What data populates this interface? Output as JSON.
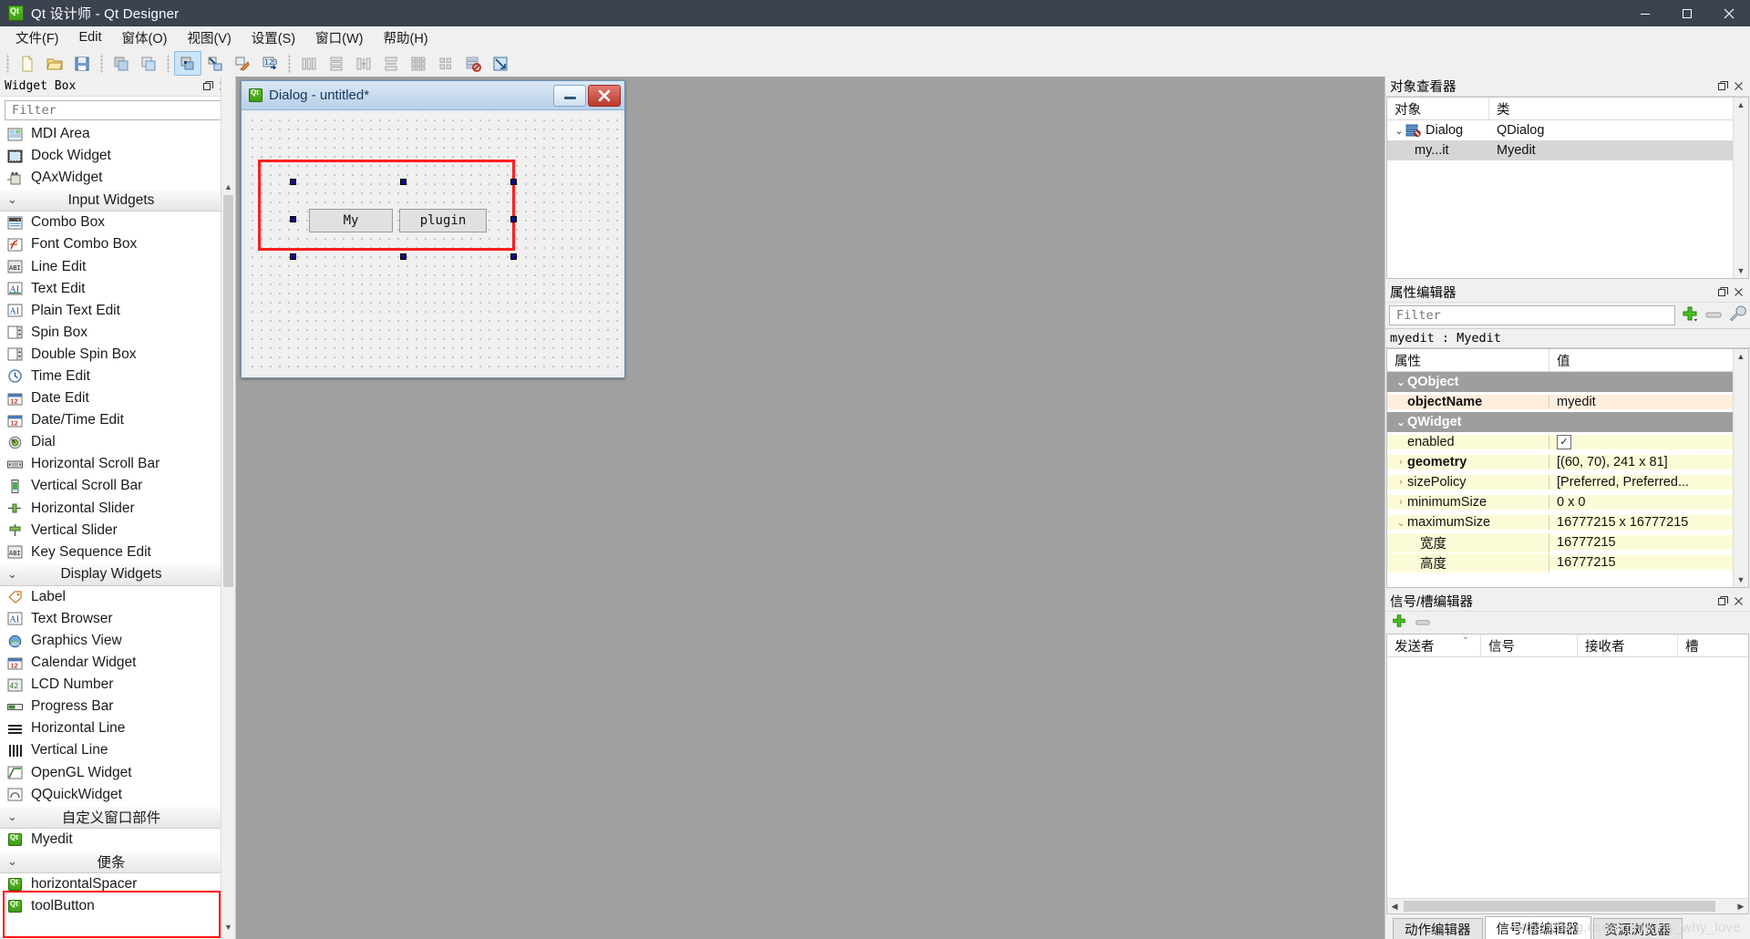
{
  "window": {
    "title": "Qt 设计师 - Qt Designer",
    "icon": "qt-logo-icon",
    "minimize": "−",
    "maximize": "□",
    "close": "✕"
  },
  "menubar": {
    "items": [
      {
        "label": "文件(F)",
        "name": "menu-file"
      },
      {
        "label": "Edit",
        "name": "menu-edit"
      },
      {
        "label": "窗体(O)",
        "name": "menu-form"
      },
      {
        "label": "视图(V)",
        "name": "menu-view"
      },
      {
        "label": "设置(S)",
        "name": "menu-settings"
      },
      {
        "label": "窗口(W)",
        "name": "menu-window"
      },
      {
        "label": "帮助(H)",
        "name": "menu-help"
      }
    ]
  },
  "toolbar": {
    "groups": [
      [
        "new-file-icon",
        "open-file-icon",
        "save-file-icon"
      ],
      [
        "undo-icon",
        "redo-icon"
      ],
      [
        "edit-widgets-icon",
        "edit-signals-slots-icon",
        "edit-buddies-icon",
        "edit-tab-order-icon"
      ],
      [
        "layout-horizontal-icon",
        "layout-vertical-icon",
        "layout-splitter-h-icon",
        "layout-splitter-v-icon",
        "layout-grid-icon",
        "layout-form-icon",
        "break-layout-icon",
        "adjust-size-icon"
      ]
    ],
    "active_index": "edit-widgets-icon"
  },
  "widget_box": {
    "panel_title": "Widget Box",
    "filter_placeholder": "Filter",
    "entries": [
      {
        "type": "item",
        "label": "MDI Area",
        "icon": "mdi-area-icon"
      },
      {
        "type": "item",
        "label": "Dock Widget",
        "icon": "dock-widget-icon"
      },
      {
        "type": "item",
        "label": "QAxWidget",
        "icon": "qax-widget-icon"
      },
      {
        "type": "category",
        "label": "Input Widgets"
      },
      {
        "type": "item",
        "label": "Combo Box",
        "icon": "combo-box-icon"
      },
      {
        "type": "item",
        "label": "Font Combo Box",
        "icon": "font-combo-box-icon"
      },
      {
        "type": "item",
        "label": "Line Edit",
        "icon": "line-edit-icon"
      },
      {
        "type": "item",
        "label": "Text Edit",
        "icon": "text-edit-icon"
      },
      {
        "type": "item",
        "label": "Plain Text Edit",
        "icon": "plain-text-edit-icon"
      },
      {
        "type": "item",
        "label": "Spin Box",
        "icon": "spin-box-icon"
      },
      {
        "type": "item",
        "label": "Double Spin Box",
        "icon": "double-spin-box-icon"
      },
      {
        "type": "item",
        "label": "Time Edit",
        "icon": "time-edit-icon"
      },
      {
        "type": "item",
        "label": "Date Edit",
        "icon": "date-edit-icon"
      },
      {
        "type": "item",
        "label": "Date/Time Edit",
        "icon": "date-time-edit-icon"
      },
      {
        "type": "item",
        "label": "Dial",
        "icon": "dial-icon"
      },
      {
        "type": "item",
        "label": "Horizontal Scroll Bar",
        "icon": "horizontal-scroll-bar-icon"
      },
      {
        "type": "item",
        "label": "Vertical Scroll Bar",
        "icon": "vertical-scroll-bar-icon"
      },
      {
        "type": "item",
        "label": "Horizontal Slider",
        "icon": "horizontal-slider-icon"
      },
      {
        "type": "item",
        "label": "Vertical Slider",
        "icon": "vertical-slider-icon"
      },
      {
        "type": "item",
        "label": "Key Sequence Edit",
        "icon": "key-sequence-edit-icon"
      },
      {
        "type": "category",
        "label": "Display Widgets"
      },
      {
        "type": "item",
        "label": "Label",
        "icon": "label-icon"
      },
      {
        "type": "item",
        "label": "Text Browser",
        "icon": "text-browser-icon"
      },
      {
        "type": "item",
        "label": "Graphics View",
        "icon": "graphics-view-icon"
      },
      {
        "type": "item",
        "label": "Calendar Widget",
        "icon": "calendar-widget-icon"
      },
      {
        "type": "item",
        "label": "LCD Number",
        "icon": "lcd-number-icon"
      },
      {
        "type": "item",
        "label": "Progress Bar",
        "icon": "progress-bar-icon"
      },
      {
        "type": "item",
        "label": "Horizontal Line",
        "icon": "horizontal-line-icon"
      },
      {
        "type": "item",
        "label": "Vertical Line",
        "icon": "vertical-line-icon"
      },
      {
        "type": "item",
        "label": "OpenGL Widget",
        "icon": "opengl-widget-icon"
      },
      {
        "type": "item",
        "label": "QQuickWidget",
        "icon": "qquick-widget-icon"
      },
      {
        "type": "category",
        "label": "自定义窗口部件"
      },
      {
        "type": "item",
        "label": "Myedit",
        "icon": "qt-custom-widget-icon"
      },
      {
        "type": "category",
        "label": "便条"
      },
      {
        "type": "item",
        "label": "horizontalSpacer",
        "icon": "qt-scratchpad-icon"
      },
      {
        "type": "item",
        "label": "toolButton",
        "icon": "qt-scratchpad-icon"
      }
    ]
  },
  "form": {
    "title": "Dialog - untitled*",
    "icon": "qt-logo-icon",
    "minimize_label": "",
    "close_label": "✕",
    "buttons": [
      {
        "label": "My",
        "name": "form-button-my"
      },
      {
        "label": "plugin",
        "name": "form-button-plugin"
      }
    ]
  },
  "object_inspector": {
    "panel_title": "对象查看器",
    "columns": [
      "对象",
      "类"
    ],
    "rows": [
      {
        "object": "Dialog",
        "class": "QDialog",
        "level": 0,
        "expanded": true,
        "selected": false
      },
      {
        "object": "my...it",
        "class": "Myedit",
        "level": 1,
        "expanded": false,
        "selected": true
      }
    ]
  },
  "property_editor": {
    "panel_title": "属性编辑器",
    "filter_placeholder": "Filter",
    "object_line": "myedit : Myedit",
    "columns": [
      "属性",
      "值"
    ],
    "rows": [
      {
        "kind": "group",
        "name": "QObject",
        "value": ""
      },
      {
        "kind": "prop",
        "name": "objectName",
        "value": "myedit",
        "bold": true,
        "shade": "a"
      },
      {
        "kind": "group",
        "name": "QWidget",
        "value": ""
      },
      {
        "kind": "prop",
        "name": "enabled",
        "value": "",
        "checkbox": true,
        "shade": "b"
      },
      {
        "kind": "prop",
        "name": "geometry",
        "value": "[(60, 70), 241 x 81]",
        "bold": true,
        "expander": "›",
        "shade": "b"
      },
      {
        "kind": "prop",
        "name": "sizePolicy",
        "value": "[Preferred, Preferred...",
        "expander": "›",
        "shade": "b"
      },
      {
        "kind": "prop",
        "name": "minimumSize",
        "value": "0 x 0",
        "expander": "›",
        "shade": "b"
      },
      {
        "kind": "prop",
        "name": "maximumSize",
        "value": "16777215 x 16777215",
        "expander": "⌄",
        "shade": "b"
      },
      {
        "kind": "sub",
        "name": "宽度",
        "value": "16777215",
        "shade": "b"
      },
      {
        "kind": "sub",
        "name": "高度",
        "value": "16777215",
        "shade": "b"
      }
    ]
  },
  "signal_slot_editor": {
    "panel_title": "信号/槽编辑器",
    "add_button": "+",
    "remove_button": "−",
    "columns": [
      "发送者",
      "信号",
      "接收者",
      "槽"
    ],
    "rows": []
  },
  "bottom_tabs": {
    "tabs": [
      {
        "label": "动作编辑器",
        "selected": false
      },
      {
        "label": "信号/槽编辑器",
        "selected": true
      },
      {
        "label": "资源浏览器",
        "selected": false
      }
    ]
  },
  "watermark": "https://blog.csdn.net/King_why_love",
  "colors": {
    "titlebar_bg": "#3b4250",
    "canvas_bg": "#a0a0a0",
    "accent_red": "#ff1e1e",
    "property_group": "#9e9e9e",
    "row_peach": "#fdeede",
    "row_yellow": "#fcfbd7"
  }
}
